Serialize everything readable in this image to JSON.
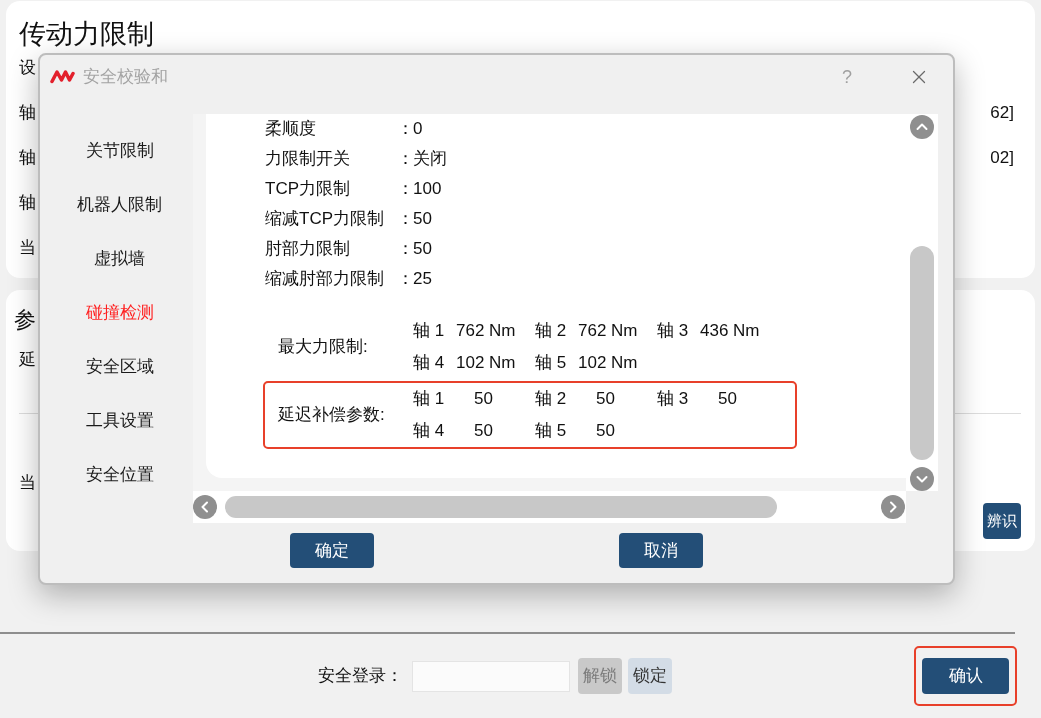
{
  "limit_card": {
    "title": "传动力限制",
    "rows": [
      {
        "label": "设"
      },
      {
        "label": "轴",
        "trailing": "62]"
      },
      {
        "label": "轴",
        "trailing": "02]"
      },
      {
        "label": "轴"
      },
      {
        "label": "当"
      }
    ]
  },
  "param_card": {
    "title": "参",
    "rows": [
      {
        "label": "延"
      },
      {
        "label": "当"
      }
    ],
    "button": "辨识"
  },
  "footer": {
    "login_label": "安全登录：",
    "buttons": [
      {
        "label": "解锁",
        "disabled": true
      },
      {
        "label": "锁定",
        "disabled": false
      }
    ],
    "confirm": {
      "label": "确认",
      "highlighted": true
    }
  },
  "dialog": {
    "title": "安全校验和",
    "help": "?",
    "nav": [
      {
        "label": "关节限制",
        "selected": false
      },
      {
        "label": "机器人限制",
        "selected": false
      },
      {
        "label": "虚拟墙",
        "selected": false
      },
      {
        "label": "碰撞检测",
        "selected": true
      },
      {
        "label": "安全区域",
        "selected": false
      },
      {
        "label": "工具设置",
        "selected": false
      },
      {
        "label": "安全位置",
        "selected": false
      }
    ],
    "settings": [
      {
        "label": "柔顺度",
        "separator": "：",
        "value": "0"
      },
      {
        "label": "力限制开关",
        "separator": "：",
        "value": "关闭"
      },
      {
        "label": "TCP力限制",
        "separator": "：",
        "value": "100"
      },
      {
        "label": "缩减TCP力限制",
        "separator": "：",
        "value": "50"
      },
      {
        "label": "肘部力限制",
        "separator": "：",
        "value": "50"
      },
      {
        "label": "缩减肘部力限制",
        "separator": "：",
        "value": "25"
      }
    ],
    "groups": [
      {
        "kind": "force",
        "label": "最大力限制:",
        "highlighted": false,
        "rows": [
          [
            {
              "axis": "轴 1",
              "value": "762 Nm"
            },
            {
              "axis": "轴 2",
              "value": "762 Nm"
            },
            {
              "axis": "轴 3",
              "value": "436 Nm"
            }
          ],
          [
            {
              "axis": "轴 4",
              "value": "102 Nm"
            },
            {
              "axis": "轴 5",
              "value": "102 Nm"
            }
          ]
        ]
      },
      {
        "kind": "compensation",
        "label": "延迟补偿参数:",
        "highlighted": true,
        "rows": [
          [
            {
              "axis": "轴 1",
              "value": "50"
            },
            {
              "axis": "轴 2",
              "value": "50"
            },
            {
              "axis": "轴 3",
              "value": "50"
            }
          ],
          [
            {
              "axis": "轴 4",
              "value": "50"
            },
            {
              "axis": "轴 5",
              "value": "50"
            }
          ]
        ]
      }
    ],
    "buttons": [
      {
        "label": "确定"
      },
      {
        "label": "取消"
      }
    ]
  }
}
